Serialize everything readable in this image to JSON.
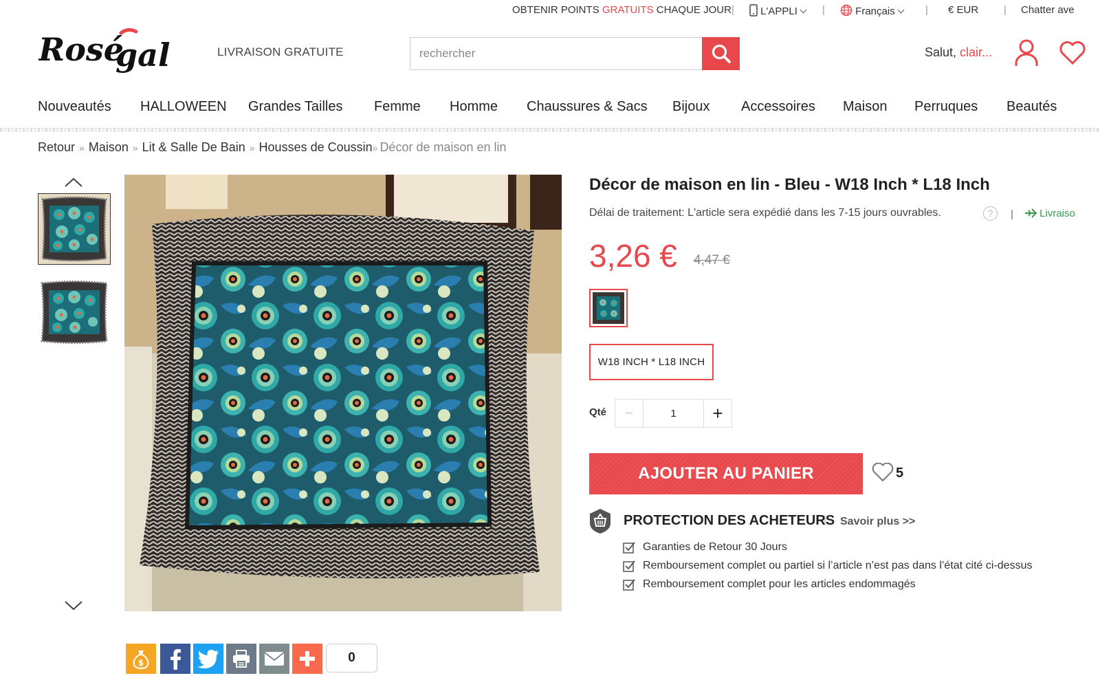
{
  "topbar": {
    "points_prefix": "OBTENIR POINTS ",
    "points_highlight": "GRATUITS",
    "points_suffix": " CHAQUE JOUR",
    "app_label": "L'APPLI",
    "language": "Français",
    "currency": "€ EUR",
    "chat": "Chatter ave"
  },
  "header": {
    "free_shipping": "LIVRAISON GRATUITE",
    "search_placeholder": "rechercher",
    "greeting": "Salut, ",
    "username": "clair..."
  },
  "nav": {
    "items": [
      "Nouveautés",
      "HALLOWEEN",
      "Grandes Tailles",
      "Femme",
      "Homme",
      "Chaussures & Sacs",
      "Bijoux",
      "Accessoires",
      "Maison",
      "Perruques",
      "Beautés"
    ]
  },
  "breadcrumb": {
    "items": [
      "Retour",
      "Maison",
      "Lit & Salle De Bain",
      "Housses de Coussin"
    ],
    "current": "Décor de maison en lin",
    "separator": "»"
  },
  "product": {
    "title": "Décor de maison en lin - Bleu - W18 Inch * L18 Inch",
    "lead_time": "Délai de traitement: L'article sera expédié dans les 7-15 jours ouvrables.",
    "help": "?",
    "separator": "|",
    "shipping_link": "Livraiso",
    "price": "3,26 €",
    "old_price": "4,47 €",
    "size": "W18 INCH * L18 INCH",
    "qty_label": "Qté",
    "qty_value": "1",
    "minus": "−",
    "plus": "+",
    "add_to_cart": "AJOUTER AU PANIER",
    "wishlist_count": "5"
  },
  "protection": {
    "title": "PROTECTION DES ACHETEURS",
    "separator": "|",
    "more": "Savoir plus >>",
    "items": [
      "Garanties de Retour 30 Jours",
      "Remboursement complet ou partiel si l’article n’est pas dans l’état cité ci-dessus",
      "Remboursement complet pour les articles endommagés"
    ]
  },
  "share": {
    "count": "0"
  },
  "colors": {
    "accent": "#e8474b",
    "facebook": "#3b5998",
    "twitter": "#1da1f2",
    "print": "#6c7a89",
    "email": "#7f8c8d",
    "addthis": "#f8694d",
    "money": "#f5a623",
    "shipping_green": "#3a9a4c"
  },
  "icons": {
    "search": "search-icon",
    "user": "user-icon",
    "heart": "heart-icon",
    "globe": "globe-icon",
    "phone": "phone-icon",
    "shield": "shield-basket-icon",
    "plane": "plane-icon"
  }
}
